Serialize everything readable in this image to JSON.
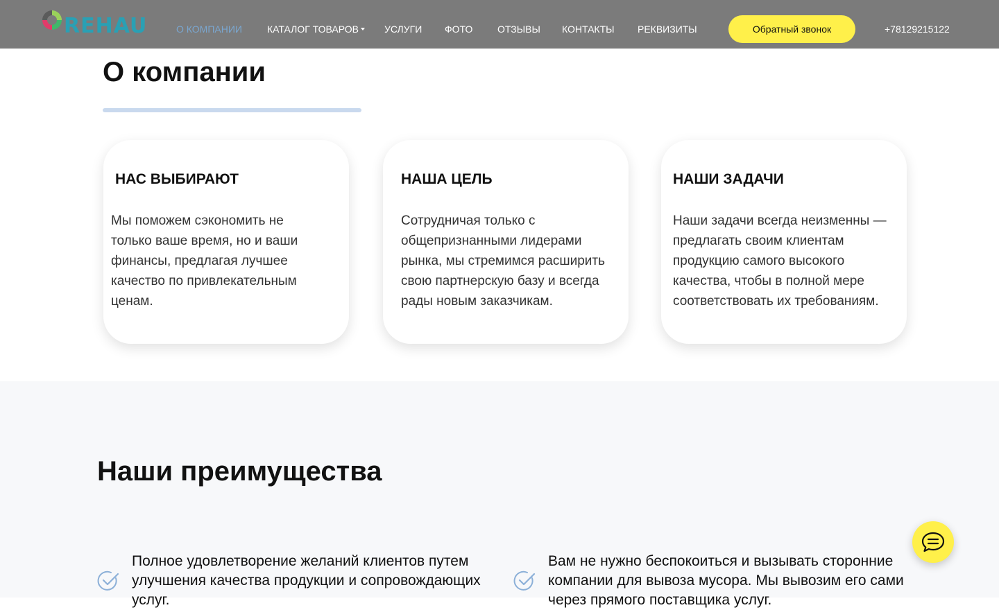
{
  "header": {
    "logo_text": "REHAU",
    "nav": [
      {
        "label": "О КОМПАНИИ",
        "active": true
      },
      {
        "label": "КАТАЛОГ ТОВАРОВ",
        "has_dropdown": true
      },
      {
        "label": "УСЛУГИ"
      },
      {
        "label": "ФОТО"
      },
      {
        "label": "ОТЗЫВЫ"
      },
      {
        "label": "КОНТАКТЫ"
      },
      {
        "label": "РЕКВИЗИТЫ"
      }
    ],
    "callback_label": "Обратный звонок",
    "phone": "+78129215122"
  },
  "about": {
    "title": "О компании",
    "cards": [
      {
        "title": "НАС ВЫБИРАЮТ",
        "text": "Мы поможем сэкономить не только ваше время, но и ваши финансы, предлагая лучшее качество по привлекательным ценам."
      },
      {
        "title": "НАША ЦЕЛЬ",
        "text": "Сотрудничая только с общепризнанными лидерами рынка, мы стремимся расширить свою партнерскую базу и всегда рады новым заказчикам."
      },
      {
        "title": "НАШИ ЗАДАЧИ",
        "text": "Наши задачи всегда неизменны — предлагать своим клиентам продукцию самого высокого качества, чтобы в полной мере соответствовать их требованиям."
      }
    ]
  },
  "advantages": {
    "title": "Наши преимущества",
    "items": [
      {
        "text": "Полное удовлетворение желаний клиентов путем улучшения качества продукции и сопровождающих услуг."
      },
      {
        "text": "Вам не нужно беспокоиться и вызывать сторонние компании для вывоза мусора. Мы вывозим его сами через прямого поставщика услуг."
      }
    ]
  },
  "icons": {
    "check": "check-circle-icon",
    "chat": "chat-icon",
    "caret": "chevron-down-icon"
  },
  "colors": {
    "header_bg": "#7b7b7b",
    "accent_yellow": "#fff04a",
    "active_nav": "#7aa6cf",
    "logo_teal": "#2aa0b4"
  }
}
